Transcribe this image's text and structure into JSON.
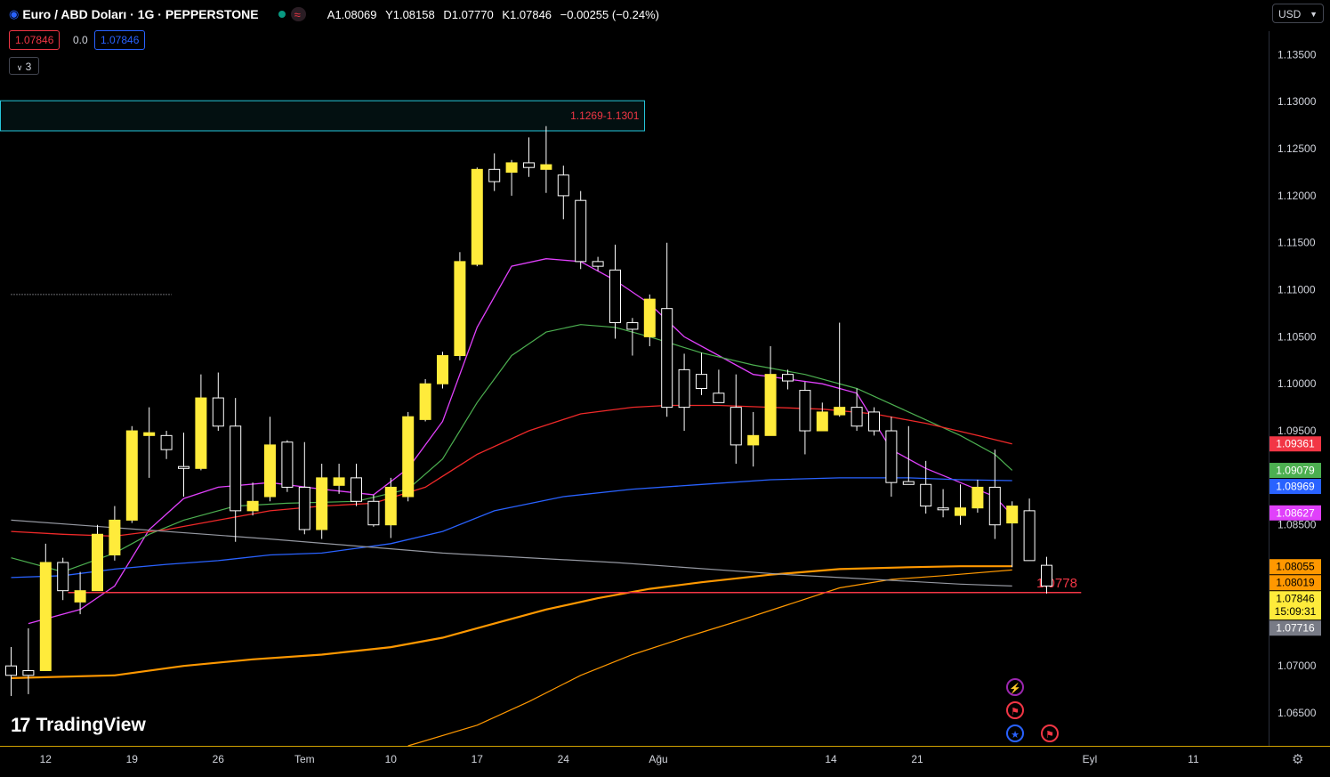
{
  "header": {
    "symbol": "Euro / ABD Doları · 1G · PEPPERSTONE",
    "ohlc": {
      "open_label": "A",
      "open": "1.08069",
      "high_label": "Y",
      "high": "1.08158",
      "low_label": "D",
      "low": "1.07770",
      "close_label": "K",
      "close": "1.07846",
      "change": "−0.00255 (−0.24%)"
    },
    "sell_price": "1.07846",
    "spread": "0.0",
    "buy_price": "1.07846",
    "indicators_count": "3",
    "currency": "USD"
  },
  "branding": {
    "logo_text": "TradingView"
  },
  "events": [
    {
      "icon": "lightning-icon",
      "color": "#9c27b0"
    },
    {
      "icon": "us-flag-icon",
      "color": "#f23645"
    },
    {
      "icon": "eu-flag-icon",
      "color": "#2962ff"
    },
    {
      "icon": "us-flag-icon",
      "color": "#f23645"
    }
  ],
  "colors": {
    "up": "#ffeb3b",
    "down": "#ffffff",
    "wick": "#ffffff",
    "bg": "#000000",
    "zone": "#26c6da",
    "support": "#f23645"
  },
  "chart_data": {
    "type": "candlestick",
    "x_ticks": [
      {
        "label": "12",
        "i": 2
      },
      {
        "label": "19",
        "i": 7
      },
      {
        "label": "26",
        "i": 12
      },
      {
        "label": "Tem",
        "i": 17
      },
      {
        "label": "10",
        "i": 22
      },
      {
        "label": "17",
        "i": 27
      },
      {
        "label": "24",
        "i": 32
      },
      {
        "label": "Ağu",
        "i": 37.5
      },
      {
        "label": "14",
        "i": 47.5
      },
      {
        "label": "21",
        "i": 52.5
      },
      {
        "label": "Eyl",
        "i": 62.5
      },
      {
        "label": "11",
        "i": 68.5
      }
    ],
    "y_ticks": [
      1.135,
      1.13,
      1.125,
      1.12,
      1.115,
      1.11,
      1.105,
      1.1,
      1.095,
      1.085,
      1.07,
      1.065
    ],
    "y_tick_labels": [
      "1.13500",
      "1.13000",
      "1.12500",
      "1.12000",
      "1.11500",
      "1.11000",
      "1.10500",
      "1.10000",
      "1.09500",
      "1.08500",
      "1.07000",
      "1.06500"
    ],
    "ylim": [
      1.0615,
      1.1375
    ],
    "candles": [
      [
        1.07,
        1.072,
        1.0668,
        1.069
      ],
      [
        1.0695,
        1.074,
        1.067,
        1.069
      ],
      [
        1.0695,
        1.083,
        1.0695,
        1.081
      ],
      [
        1.081,
        1.0815,
        1.077,
        1.078
      ],
      [
        1.0768,
        1.08,
        1.0755,
        1.078
      ],
      [
        1.078,
        1.085,
        1.078,
        1.084
      ],
      [
        1.0818,
        1.087,
        1.0812,
        1.0855
      ],
      [
        1.0855,
        1.0955,
        1.0852,
        1.095
      ],
      [
        1.0945,
        1.0975,
        1.09,
        1.0948
      ],
      [
        1.0945,
        1.095,
        1.092,
        1.093
      ],
      [
        1.0912,
        1.0948,
        1.088,
        1.091
      ],
      [
        1.091,
        1.101,
        1.0908,
        1.0985
      ],
      [
        1.0985,
        1.1012,
        1.095,
        1.0955
      ],
      [
        1.0955,
        1.0985,
        1.0832,
        1.0865
      ],
      [
        1.0865,
        1.0895,
        1.086,
        1.0875
      ],
      [
        1.088,
        1.0965,
        1.0875,
        1.0935
      ],
      [
        1.0938,
        1.094,
        1.0885,
        1.089
      ],
      [
        1.089,
        1.0938,
        1.084,
        1.0845
      ],
      [
        1.0845,
        1.0915,
        1.0835,
        1.09
      ],
      [
        1.0892,
        1.0915,
        1.0883,
        1.09
      ],
      [
        1.09,
        1.0915,
        1.087,
        1.0875
      ],
      [
        1.0875,
        1.0882,
        1.0848,
        1.085
      ],
      [
        1.085,
        1.09,
        1.0836,
        1.089
      ],
      [
        1.088,
        1.097,
        1.0875,
        1.0965
      ],
      [
        1.0962,
        1.1005,
        1.096,
        1.1
      ],
      [
        1.1,
        1.1034,
        1.0995,
        1.103
      ],
      [
        1.103,
        1.114,
        1.1025,
        1.113
      ],
      [
        1.1127,
        1.123,
        1.1125,
        1.1228
      ],
      [
        1.1228,
        1.1245,
        1.1205,
        1.1215
      ],
      [
        1.1225,
        1.1238,
        1.12,
        1.1235
      ],
      [
        1.1235,
        1.1262,
        1.122,
        1.123
      ],
      [
        1.1228,
        1.1274,
        1.1203,
        1.1233
      ],
      [
        1.1222,
        1.1232,
        1.1175,
        1.12
      ],
      [
        1.1195,
        1.1205,
        1.1122,
        1.113
      ],
      [
        1.113,
        1.1135,
        1.112,
        1.1125
      ],
      [
        1.1121,
        1.1148,
        1.1048,
        1.1065
      ],
      [
        1.1065,
        1.107,
        1.103,
        1.1058
      ],
      [
        1.105,
        1.1095,
        1.104,
        1.109
      ],
      [
        1.108,
        1.115,
        1.0965,
        1.0975
      ],
      [
        1.1015,
        1.1032,
        1.095,
        1.0975
      ],
      [
        1.101,
        1.1033,
        1.0988,
        1.0995
      ],
      [
        1.099,
        1.1015,
        1.099,
        1.098
      ],
      [
        1.0975,
        1.101,
        1.0915,
        1.0935
      ],
      [
        1.0935,
        1.097,
        1.0912,
        1.0945
      ],
      [
        1.0945,
        1.104,
        1.0945,
        1.101
      ],
      [
        1.101,
        1.1015,
        1.0994,
        1.1003
      ],
      [
        1.0993,
        1.1002,
        1.0925,
        1.095
      ],
      [
        1.095,
        1.098,
        1.095,
        1.097
      ],
      [
        1.0967,
        1.1065,
        1.0965,
        1.0975
      ],
      [
        1.0975,
        1.0995,
        1.095,
        1.0955
      ],
      [
        1.097,
        1.0975,
        1.0945,
        1.095
      ],
      [
        1.095,
        1.0965,
        1.088,
        1.0895
      ],
      [
        1.0896,
        1.0955,
        1.0895,
        1.0893
      ],
      [
        1.0893,
        1.0918,
        1.0862,
        1.087
      ],
      [
        1.0868,
        1.0888,
        1.0858,
        1.0866
      ],
      [
        1.086,
        1.0893,
        1.085,
        1.0868
      ],
      [
        1.0868,
        1.0898,
        1.0863,
        1.089
      ],
      [
        1.089,
        1.093,
        1.0835,
        1.085
      ],
      [
        1.0852,
        1.0875,
        1.0805,
        1.087
      ],
      [
        1.0865,
        1.0878,
        1.0812,
        1.0812
      ],
      [
        1.0807,
        1.0816,
        1.0777,
        1.0785
      ]
    ],
    "ma_lines": [
      {
        "color": "#e040fb",
        "width": 1.3,
        "pts": [
          [
            1,
            1.0745
          ],
          [
            4,
            1.076
          ],
          [
            6,
            1.0785
          ],
          [
            8,
            1.0845
          ],
          [
            10,
            1.0878
          ],
          [
            12,
            1.089
          ],
          [
            15,
            1.0895
          ],
          [
            18,
            1.0888
          ],
          [
            21,
            1.0882
          ],
          [
            23,
            1.091
          ],
          [
            25,
            1.096
          ],
          [
            27,
            1.106
          ],
          [
            29,
            1.1125
          ],
          [
            31,
            1.1133
          ],
          [
            33,
            1.113
          ],
          [
            35,
            1.111
          ],
          [
            37,
            1.1085
          ],
          [
            39,
            1.105
          ],
          [
            41,
            1.103
          ],
          [
            43,
            1.101
          ],
          [
            45,
            1.1005
          ],
          [
            47,
            1.1
          ],
          [
            49,
            1.099
          ],
          [
            51,
            1.093
          ],
          [
            53,
            1.091
          ],
          [
            55,
            1.0895
          ],
          [
            57,
            1.088
          ],
          [
            58,
            1.086
          ]
        ]
      },
      {
        "color": "#4caf50",
        "width": 1.2,
        "pts": [
          [
            0,
            1.0815
          ],
          [
            3,
            1.08
          ],
          [
            6,
            1.082
          ],
          [
            8,
            1.084
          ],
          [
            10,
            1.0855
          ],
          [
            13,
            1.087
          ],
          [
            16,
            1.0873
          ],
          [
            20,
            1.0875
          ],
          [
            23,
            1.0888
          ],
          [
            25,
            1.092
          ],
          [
            27,
            1.098
          ],
          [
            29,
            1.103
          ],
          [
            31,
            1.1055
          ],
          [
            33,
            1.1063
          ],
          [
            35,
            1.106
          ],
          [
            37,
            1.105
          ],
          [
            40,
            1.1033
          ],
          [
            43,
            1.102
          ],
          [
            46,
            1.101
          ],
          [
            49,
            1.0995
          ],
          [
            52,
            1.097
          ],
          [
            55,
            1.0945
          ],
          [
            57,
            1.0925
          ],
          [
            58,
            1.0908
          ]
        ]
      },
      {
        "color": "#ef2929",
        "width": 1.3,
        "pts": [
          [
            0,
            1.0843
          ],
          [
            3,
            1.084
          ],
          [
            6,
            1.0838
          ],
          [
            9,
            1.0845
          ],
          [
            12,
            1.0855
          ],
          [
            15,
            1.0865
          ],
          [
            18,
            1.087
          ],
          [
            21,
            1.0873
          ],
          [
            24,
            1.089
          ],
          [
            27,
            1.0925
          ],
          [
            30,
            1.095
          ],
          [
            33,
            1.0968
          ],
          [
            36,
            1.0975
          ],
          [
            38,
            1.0977
          ],
          [
            41,
            1.0977
          ],
          [
            44,
            1.0975
          ],
          [
            47,
            1.0973
          ],
          [
            50,
            1.0968
          ],
          [
            53,
            1.0958
          ],
          [
            56,
            1.0945
          ],
          [
            58,
            1.0936
          ]
        ]
      },
      {
        "color": "#2962ff",
        "width": 1.3,
        "pts": [
          [
            0,
            1.0794
          ],
          [
            3,
            1.0796
          ],
          [
            6,
            1.0803
          ],
          [
            9,
            1.0808
          ],
          [
            12,
            1.0812
          ],
          [
            15,
            1.0818
          ],
          [
            18,
            1.082
          ],
          [
            22,
            1.083
          ],
          [
            25,
            1.0843
          ],
          [
            28,
            1.0865
          ],
          [
            32,
            1.088
          ],
          [
            36,
            1.0888
          ],
          [
            40,
            1.0893
          ],
          [
            44,
            1.0898
          ],
          [
            48,
            1.09
          ],
          [
            52,
            1.09
          ],
          [
            55,
            1.0898
          ],
          [
            58,
            1.0897
          ]
        ]
      },
      {
        "color": "#ff9800",
        "width": 2.2,
        "pts": [
          [
            0,
            1.0687
          ],
          [
            6,
            1.069
          ],
          [
            10,
            1.07
          ],
          [
            14,
            1.0707
          ],
          [
            18,
            1.0712
          ],
          [
            22,
            1.072
          ],
          [
            25,
            1.073
          ],
          [
            28,
            1.0745
          ],
          [
            31,
            1.076
          ],
          [
            34,
            1.0772
          ],
          [
            37,
            1.0782
          ],
          [
            40,
            1.0789
          ],
          [
            44,
            1.0797
          ],
          [
            48,
            1.0803
          ],
          [
            52,
            1.0805
          ],
          [
            55,
            1.0806
          ],
          [
            58,
            1.0806
          ]
        ]
      },
      {
        "color": "#ff9800",
        "width": 1.2,
        "pts": [
          [
            23,
            1.0615
          ],
          [
            27,
            1.0637
          ],
          [
            30,
            1.0662
          ],
          [
            33,
            1.069
          ],
          [
            36,
            1.0712
          ],
          [
            39,
            1.073
          ],
          [
            42,
            1.0747
          ],
          [
            45,
            1.0765
          ],
          [
            48,
            1.0783
          ],
          [
            51,
            1.0792
          ],
          [
            54,
            1.0796
          ],
          [
            58,
            1.0802
          ]
        ]
      },
      {
        "color": "#9598a1",
        "width": 1.2,
        "pts": [
          [
            0,
            1.0855
          ],
          [
            15,
            1.0835
          ],
          [
            25,
            1.082
          ],
          [
            35,
            1.081
          ],
          [
            45,
            1.0797
          ],
          [
            55,
            1.0787
          ],
          [
            58,
            1.0785
          ]
        ]
      }
    ],
    "zone": {
      "from_i": 0,
      "to_i": 36.7,
      "low": 1.1269,
      "high": 1.1301,
      "label": "1.1269-1.1301"
    },
    "support": {
      "from_i": 3.3,
      "to_i": 62,
      "level": 1.0778,
      "label": "1.0778"
    },
    "dotted_level": {
      "from_i": 0,
      "to_i": 9.3,
      "level": 1.1095
    },
    "price_labels": [
      {
        "value": 1.09361,
        "text": "1.09361",
        "bg": "#f23645",
        "fg": "#ffffff"
      },
      {
        "value": 1.09079,
        "text": "1.09079",
        "bg": "#4caf50",
        "fg": "#ffffff"
      },
      {
        "value": 1.08969,
        "text": "1.08969",
        "bg": "#2962ff",
        "fg": "#ffffff"
      },
      {
        "value": 1.08627,
        "text": "1.08627",
        "bg": "#e040fb",
        "fg": "#ffffff"
      },
      {
        "value": 1.08055,
        "text": "1.08055",
        "bg": "#ff9800",
        "fg": "#000000"
      },
      {
        "value": 1.08019,
        "text": "1.08019",
        "bg": "#ff9800",
        "fg": "#000000"
      },
      {
        "value": 1.07846,
        "text": "1.07846",
        "sub": "15:09:31",
        "bg": "#ffeb3b",
        "fg": "#000000"
      },
      {
        "value": 1.07716,
        "text": "1.07716",
        "bg": "#787b86",
        "fg": "#ffffff"
      }
    ]
  }
}
